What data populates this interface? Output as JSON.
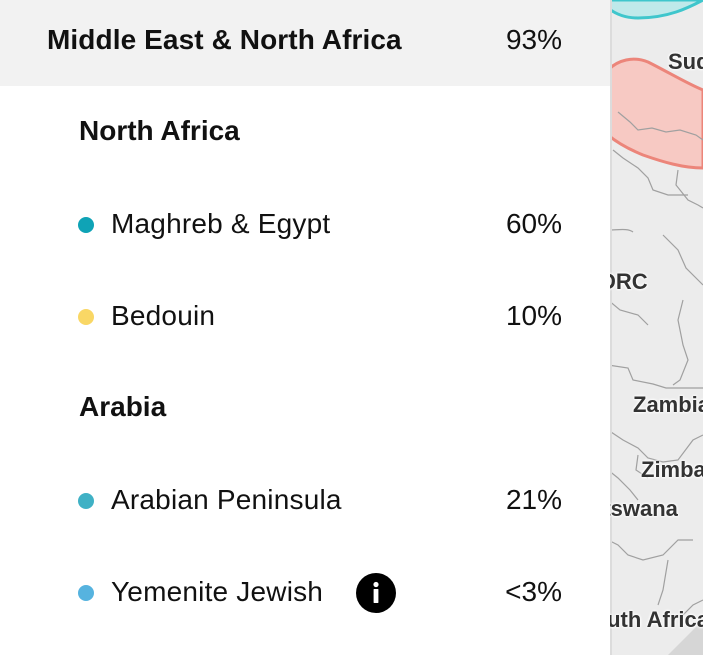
{
  "region": {
    "name": "Middle East & North Africa",
    "percent": "93%"
  },
  "groups": [
    {
      "name": "North Africa",
      "populations": [
        {
          "name": "Maghreb & Egypt",
          "percent": "60%",
          "color": "#0fa3b6",
          "info": false
        },
        {
          "name": "Bedouin",
          "percent": "10%",
          "color": "#f9d765",
          "info": false
        }
      ]
    },
    {
      "name": "Arabia",
      "populations": [
        {
          "name": "Arabian Peninsula",
          "percent": "21%",
          "color": "#3fb1c5",
          "info": false
        },
        {
          "name": "Yemenite Jewish",
          "percent": "<3%",
          "color": "#56b3df",
          "info": true
        }
      ]
    }
  ],
  "map": {
    "labels": [
      "Sud",
      "DRC",
      "Zambia",
      "Zimba",
      "Botswana",
      "South Africa"
    ],
    "colors": {
      "teal_region": "#3fc6cc",
      "red_region": "#f4a8a0",
      "land": "#ececec"
    }
  }
}
